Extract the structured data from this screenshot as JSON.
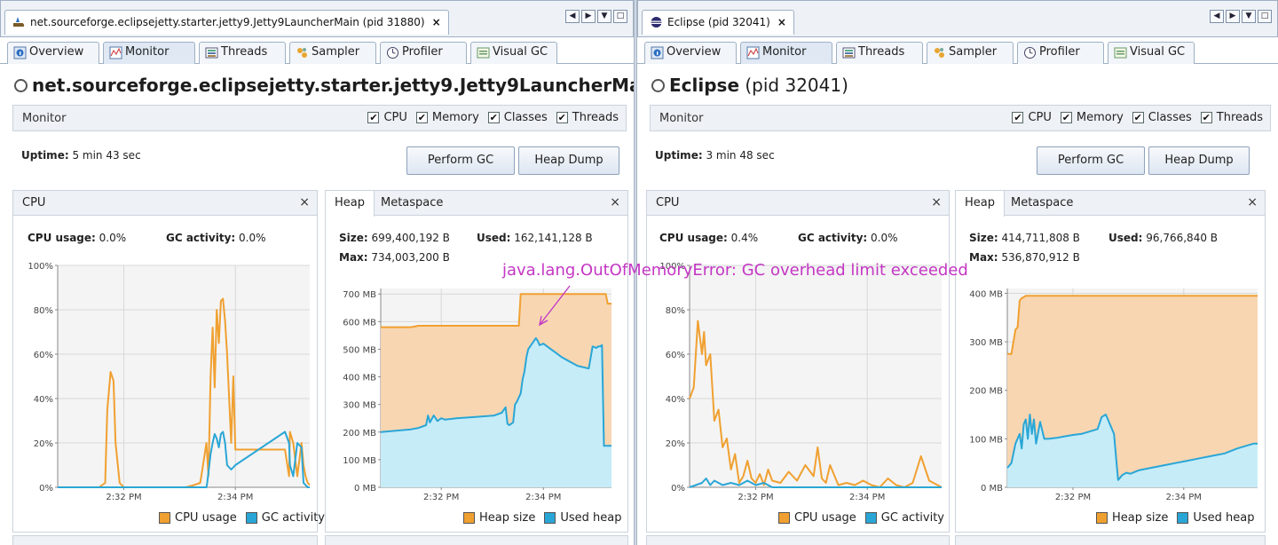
{
  "colors": {
    "cpu": "#f0a030",
    "gc": "#2aa6d6",
    "heap_fill": "#f8d6b2",
    "heap_line": "#f0a030",
    "used_fill": "#c6ecf8",
    "used_line": "#2aa6d6",
    "annotation": "#c436c4",
    "grid": "#d8d8d8"
  },
  "annotation": {
    "text": "java.lang.OutOfMemoryError: GC overhead limit exceeded"
  },
  "left": {
    "doc_tab": "net.sourceforge.eclipsejetty.starter.jetty9.Jetty9LauncherMain (pid 31880)",
    "doc_tab_close": "×",
    "tabs": [
      "Overview",
      "Monitor",
      "Threads",
      "Sampler",
      "Profiler",
      "Visual GC"
    ],
    "title": "net.sourceforge.eclipsejetty.starter.jetty9.Jetty9LauncherMa",
    "pid": "",
    "monitor_label": "Monitor",
    "checks": [
      "CPU",
      "Memory",
      "Classes",
      "Threads"
    ],
    "uptime_label": "Uptime:",
    "uptime_value": "5 min 43 sec",
    "perform_gc": "Perform GC",
    "heap_dump": "Heap Dump",
    "cpu_panel": {
      "title": "CPU",
      "close": "×",
      "usage_label": "CPU usage:",
      "usage_value": "0.0%",
      "gc_label": "GC activity:",
      "gc_value": "0.0%"
    },
    "heap_panel": {
      "tab_heap": "Heap",
      "tab_meta": "Metaspace",
      "close": "×",
      "size_label": "Size:",
      "size_value": "699,400,192 B",
      "used_label": "Used:",
      "used_value": "162,141,128 B",
      "max_label": "Max:",
      "max_value": "734,003,200 B"
    },
    "cpu_legend": [
      "CPU usage",
      "GC activity"
    ],
    "heap_legend": [
      "Heap size",
      "Used heap"
    ]
  },
  "right": {
    "doc_tab": "Eclipse (pid 32041)",
    "doc_tab_close": "×",
    "tabs": [
      "Overview",
      "Monitor",
      "Threads",
      "Sampler",
      "Profiler",
      "Visual GC"
    ],
    "title": "Eclipse",
    "pid": "(pid 32041)",
    "monitor_label": "Monitor",
    "checks": [
      "CPU",
      "Memory",
      "Classes",
      "Threads"
    ],
    "uptime_label": "Uptime:",
    "uptime_value": "3 min 48 sec",
    "perform_gc": "Perform GC",
    "heap_dump": "Heap Dump",
    "cpu_panel": {
      "title": "CPU",
      "close": "×",
      "usage_label": "CPU usage:",
      "usage_value": "0.4%",
      "gc_label": "GC activity:",
      "gc_value": "0.0%"
    },
    "heap_panel": {
      "tab_heap": "Heap",
      "tab_meta": "Metaspace",
      "close": "×",
      "size_label": "Size:",
      "size_value": "414,711,808 B",
      "used_label": "Used:",
      "used_value": "96,766,840 B",
      "max_label": "Max:",
      "max_value": "536,870,912 B"
    },
    "cpu_legend": [
      "CPU usage",
      "GC activity"
    ],
    "heap_legend": [
      "Heap size",
      "Used heap"
    ]
  },
  "chart_data": [
    {
      "id": "left-cpu",
      "type": "line",
      "ylim": [
        0,
        100
      ],
      "yticks": [
        "0%",
        "20%",
        "40%",
        "60%",
        "80%",
        "100%"
      ],
      "ytick_values": [
        0,
        20,
        40,
        60,
        80,
        100
      ],
      "xlim": [
        0,
        6.1
      ],
      "xticks": [
        "2:32 PM",
        "2:34 PM"
      ],
      "xtick_values": [
        1.6,
        4.3
      ],
      "series": [
        {
          "name": "CPU usage",
          "x": [
            0,
            1.0,
            1.15,
            1.2,
            1.28,
            1.35,
            1.4,
            1.5,
            1.6,
            1.7,
            1.8,
            2.0,
            2.3,
            2.6,
            2.9,
            3.1,
            3.3,
            3.45,
            3.5,
            3.6,
            3.65,
            3.7,
            3.75,
            3.8,
            3.85,
            3.9,
            3.95,
            4.0,
            4.05,
            4.1,
            4.15,
            4.2,
            4.25,
            4.3,
            5.5,
            5.6,
            5.62,
            5.7,
            5.8,
            5.9,
            5.95,
            6.0,
            6.05,
            6.1
          ],
          "y": [
            0,
            0,
            2,
            35,
            52,
            48,
            20,
            2,
            0,
            0,
            0,
            0,
            0,
            0,
            0,
            0,
            1,
            2,
            8,
            20,
            5,
            50,
            72,
            45,
            80,
            65,
            84,
            85,
            75,
            60,
            40,
            20,
            50,
            17,
            17,
            5,
            25,
            20,
            5,
            20,
            10,
            5,
            2,
            1
          ]
        },
        {
          "name": "GC activity",
          "x": [
            0,
            3.6,
            3.62,
            3.7,
            3.75,
            3.8,
            3.85,
            3.9,
            3.95,
            4.0,
            4.05,
            4.1,
            4.2,
            4.3,
            5.5,
            5.6,
            5.62,
            5.7,
            5.8,
            5.9,
            5.95,
            6.0,
            6.05,
            6.1
          ],
          "y": [
            0,
            0,
            2,
            15,
            20,
            24,
            22,
            18,
            24,
            25,
            20,
            10,
            8,
            10,
            25,
            20,
            10,
            5,
            20,
            18,
            2,
            1,
            0,
            0
          ]
        }
      ]
    },
    {
      "id": "left-heap",
      "type": "area",
      "ylim": [
        0,
        720
      ],
      "yticks": [
        "0 MB",
        "100 MB",
        "200 MB",
        "300 MB",
        "400 MB",
        "500 MB",
        "600 MB",
        "700 MB"
      ],
      "ytick_values": [
        0,
        100,
        200,
        300,
        400,
        500,
        600,
        700
      ],
      "xlim": [
        0,
        6.1
      ],
      "xticks": [
        "2:32 PM",
        "2:34 PM"
      ],
      "xtick_values": [
        1.6,
        4.3
      ],
      "series": [
        {
          "name": "Heap size",
          "x": [
            0,
            0.8,
            1.0,
            3.65,
            3.7,
            5.95,
            6.0,
            6.1
          ],
          "y": [
            580,
            580,
            585,
            585,
            700,
            700,
            665,
            665
          ]
        },
        {
          "name": "Used heap",
          "x": [
            0,
            0.4,
            0.8,
            1.0,
            1.2,
            1.25,
            1.3,
            1.4,
            1.5,
            1.6,
            1.7,
            2.0,
            2.5,
            3.0,
            3.2,
            3.3,
            3.35,
            3.4,
            3.45,
            3.5,
            3.55,
            3.6,
            3.7,
            3.75,
            3.8,
            3.85,
            3.9,
            4.0,
            4.1,
            4.15,
            4.2,
            4.3,
            4.5,
            4.8,
            5.2,
            5.5,
            5.6,
            5.7,
            5.75,
            5.8,
            5.85,
            5.9,
            5.95,
            6.0,
            6.05,
            6.1
          ],
          "y": [
            200,
            205,
            210,
            215,
            225,
            260,
            235,
            260,
            240,
            250,
            245,
            250,
            255,
            260,
            270,
            290,
            230,
            225,
            230,
            235,
            300,
            310,
            340,
            390,
            420,
            470,
            500,
            520,
            540,
            530,
            515,
            520,
            500,
            470,
            440,
            430,
            510,
            505,
            510,
            510,
            515,
            150,
            150,
            150,
            150,
            150
          ]
        }
      ]
    },
    {
      "id": "right-cpu",
      "type": "line",
      "ylim": [
        0,
        100
      ],
      "yticks": [
        "0%",
        "20%",
        "40%",
        "60%",
        "80%",
        "100%"
      ],
      "ytick_values": [
        0,
        20,
        40,
        60,
        80,
        100
      ],
      "xlim": [
        0,
        6.1
      ],
      "xticks": [
        "2:32 PM",
        "2:34 PM"
      ],
      "xtick_values": [
        1.6,
        4.3
      ],
      "series": [
        {
          "name": "CPU usage",
          "x": [
            0,
            0.1,
            0.2,
            0.3,
            0.35,
            0.4,
            0.5,
            0.6,
            0.7,
            0.8,
            0.9,
            1.0,
            1.1,
            1.2,
            1.3,
            1.4,
            1.5,
            1.6,
            1.7,
            1.8,
            1.9,
            2.0,
            2.2,
            2.4,
            2.6,
            2.8,
            3.0,
            3.1,
            3.2,
            3.3,
            3.4,
            3.6,
            3.8,
            4.0,
            4.2,
            4.4,
            4.6,
            4.8,
            5.0,
            5.2,
            5.4,
            5.6,
            5.8,
            6.0,
            6.1
          ],
          "y": [
            40,
            45,
            75,
            60,
            70,
            55,
            60,
            30,
            35,
            18,
            22,
            8,
            15,
            2,
            5,
            12,
            4,
            2,
            6,
            1,
            8,
            3,
            2,
            7,
            3,
            10,
            5,
            18,
            4,
            2,
            10,
            1,
            2,
            1,
            3,
            1,
            0,
            4,
            1,
            0,
            2,
            14,
            3,
            1,
            0
          ]
        },
        {
          "name": "GC activity",
          "x": [
            0,
            0.3,
            0.4,
            0.5,
            0.6,
            0.8,
            1.0,
            1.2,
            1.4,
            1.6,
            1.8,
            2.0,
            6.1
          ],
          "y": [
            0,
            2,
            4,
            1,
            3,
            1,
            2,
            1,
            3,
            1,
            2,
            0,
            0
          ]
        }
      ]
    },
    {
      "id": "right-heap",
      "type": "area",
      "ylim": [
        0,
        410
      ],
      "yticks": [
        "0 MB",
        "100 MB",
        "200 MB",
        "300 MB",
        "400 MB"
      ],
      "ytick_values": [
        0,
        100,
        200,
        300,
        400
      ],
      "xlim": [
        0,
        6.1
      ],
      "xticks": [
        "2:32 PM",
        "2:34 PM"
      ],
      "xtick_values": [
        1.6,
        4.3
      ],
      "series": [
        {
          "name": "Heap size",
          "x": [
            0,
            0.1,
            0.2,
            0.25,
            0.3,
            0.35,
            0.4,
            0.45,
            0.5,
            6.1
          ],
          "y": [
            275,
            275,
            325,
            330,
            385,
            390,
            392,
            395,
            395,
            395
          ]
        },
        {
          "name": "Used heap",
          "x": [
            0,
            0.1,
            0.2,
            0.3,
            0.35,
            0.4,
            0.45,
            0.5,
            0.55,
            0.6,
            0.65,
            0.7,
            0.8,
            0.9,
            1.0,
            1.2,
            1.4,
            1.6,
            1.8,
            2.0,
            2.2,
            2.3,
            2.4,
            2.6,
            2.7,
            2.8,
            2.9,
            3.0,
            3.2,
            3.5,
            3.8,
            4.1,
            4.4,
            4.7,
            5.0,
            5.3,
            5.6,
            5.8,
            6.0,
            6.1
          ],
          "y": [
            40,
            50,
            90,
            110,
            80,
            130,
            140,
            100,
            150,
            110,
            140,
            90,
            135,
            100,
            100,
            102,
            105,
            108,
            110,
            115,
            120,
            145,
            150,
            110,
            15,
            25,
            30,
            28,
            35,
            40,
            45,
            50,
            55,
            60,
            65,
            70,
            80,
            85,
            90,
            90
          ]
        }
      ]
    }
  ]
}
